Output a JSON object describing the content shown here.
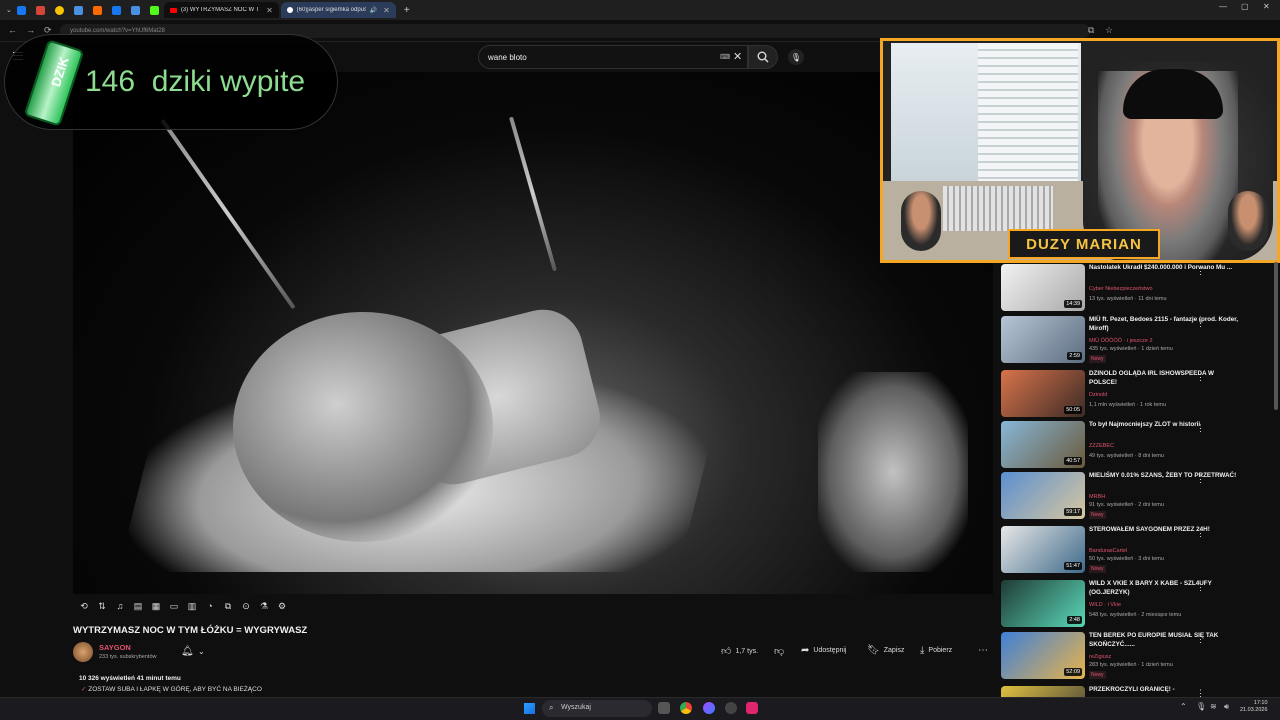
{
  "browser": {
    "tabs": [
      {
        "title": "(3) WYTRZYMASZ NOC W TYM ŁÓŻKU",
        "active": true
      },
      {
        "title": "(60)jasper sigiemka odpuś",
        "active": false
      }
    ],
    "url": "youtube.com/watch?v=YhUf6Mat28"
  },
  "youtube": {
    "search_value": "wane bloto",
    "video": {
      "title": "WYTRZYMASZ NOC W TYM ŁÓŻKU = WYGRYWASZ",
      "channel": "SAYGON",
      "subscribers": "233 tys. subskrybentów",
      "likes": "1,7 tys.",
      "share": "Udostępnij",
      "save": "Zapisz",
      "download": "Pobierz",
      "views_time": "10 326 wyświetleń  41 minut temu",
      "description": "ZOSTAW SUBA I ŁAPKĘ W GÓRĘ, ABY BYĆ NA BIEŻĄCO"
    },
    "recommendations": [
      {
        "title": "Nastolatek Ukradł $240.000.000 i Porwano Mu ...",
        "channel": "Cyber Niebezpieczeństwo",
        "meta": "13 tys. wyświetleń · 11 dni temu",
        "duration": "14:39",
        "new": ""
      },
      {
        "title": "MIÜ ft. Pezet, Bedoes 2115 - fantazje (prod. Koder, Miroff)",
        "channel": "MIÜ ÖÖÖÖÖ · i jeszcze 2",
        "meta": "435 tys. wyświetleń · 1 dzień temu",
        "duration": "2:59",
        "new": "Nowy"
      },
      {
        "title": "DZINOLD OGLĄDA IRL ISHOWSPEEDA W POLSCE!",
        "channel": "Dzinold",
        "meta": "1,1 mln wyświetleń · 1 rok temu",
        "duration": "50:05",
        "new": ""
      },
      {
        "title": "To był Najmocniejszy ZLOT w historii",
        "channel": "ZZZEBEC",
        "meta": "49 tys. wyświetleń · 8 dni temu",
        "duration": "40:57",
        "new": ""
      },
      {
        "title": "MIELIŚMY 0.01% SZANS, ŻEBY TO PRZETRWAĆ!",
        "channel": "MRBH",
        "meta": "91 tys. wyświetleń · 2 dni temu",
        "duration": "59:17",
        "new": "Nowy"
      },
      {
        "title": "STEROWAŁEM SAYGONEM PRZEZ 24H!",
        "channel": "BandurasCartel",
        "meta": "50 tys. wyświetleń · 3 dni temu",
        "duration": "51:47",
        "new": "Nowy"
      },
      {
        "title": "WILD X VKIE X BARY X KABE - SZL4UFY (OG.JERZYK)",
        "channel": "WILD · i Vkie",
        "meta": "548 tys. wyświetleń · 2 miesiące temu",
        "duration": "2:48",
        "new": ""
      },
      {
        "title": "TEN BEREK PO EUROPIE MUSIAŁ SIĘ TAK SKOŃCZYĆ......",
        "channel": "reZigiusz",
        "meta": "283 tys. wyświetleń · 1 dzień temu",
        "duration": "52:09",
        "new": "Nowy"
      },
      {
        "title": "PRZEKROCZYLI GRANICĘ! -",
        "channel": "",
        "meta": "",
        "duration": "",
        "new": ""
      }
    ]
  },
  "overlay": {
    "can_label": "DZIK",
    "counter_text": "146  dziki wypite",
    "cam_label": "DUZY MARIAN"
  },
  "taskbar": {
    "search": "Wyszukaj",
    "time": "17:10",
    "date": "21.03.2026"
  },
  "colors": {
    "accent": "#f5a623",
    "channel_red": "#e0546e",
    "counter_green": "#8ddc8f"
  }
}
